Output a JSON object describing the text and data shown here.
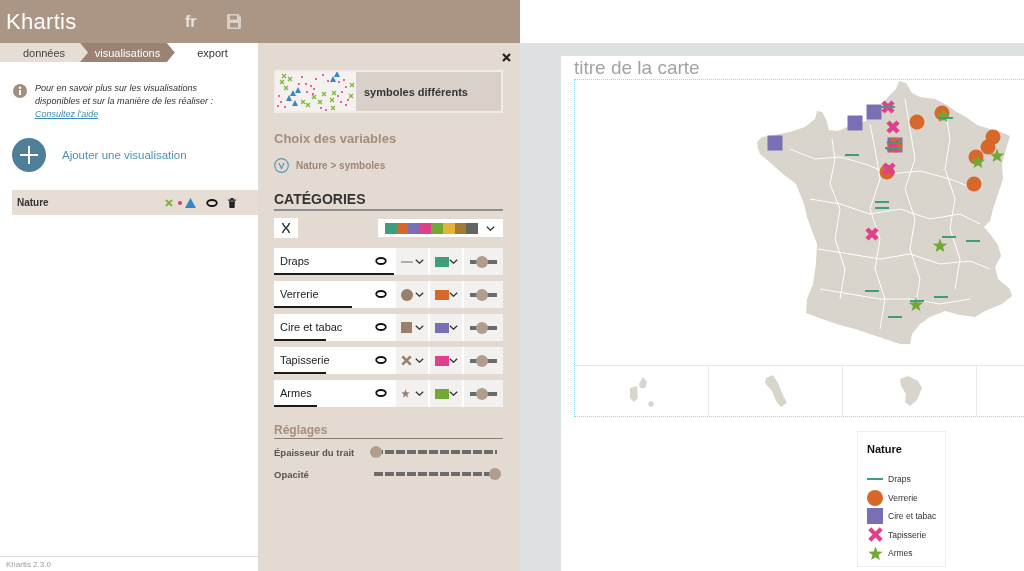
{
  "header": {
    "logo": "Khartis",
    "language": "fr"
  },
  "steps": [
    {
      "label": "données",
      "selected": false
    },
    {
      "label": "visualisations",
      "selected": true
    },
    {
      "label": "export",
      "selected": false
    }
  ],
  "info": {
    "text": "Pour en savoir plus sur les visualisations disponibles et sur la manière de les réaliser :",
    "link": "Consultez l'aide"
  },
  "add_button": {
    "label": "Ajouter une visualisation"
  },
  "visualizations": [
    {
      "name": "Nature",
      "selected": true,
      "visible": true
    }
  ],
  "footer": {
    "version": "Khartis 2.3.0"
  },
  "panel": {
    "viz_type": {
      "label": "symboles différents"
    },
    "variables_heading": "Choix des variables",
    "variable": {
      "label": "Nature > symboles"
    },
    "categories_heading": "CATÉGORIES",
    "palette": [
      {
        "color": "#3e9e7c"
      },
      {
        "color": "#d6692a"
      },
      {
        "color": "#7a6fb4"
      },
      {
        "color": "#df3f8b"
      },
      {
        "color": "#71a836"
      },
      {
        "color": "#e6b23c"
      },
      {
        "color": "#a27a33"
      },
      {
        "color": "#646464"
      }
    ],
    "categories": [
      {
        "name": "Draps",
        "visible": true,
        "kind": "line",
        "color": "#3e9e7c",
        "count_bar": {
          "level": 1
        },
        "size": {
          "level": 0.45
        }
      },
      {
        "name": "Verrerie",
        "visible": true,
        "kind": "circle",
        "color": "#d6692a",
        "count_bar": {
          "level": 0.65
        },
        "size": {
          "level": 0.45
        }
      },
      {
        "name": "Cire et tabac",
        "visible": true,
        "kind": "square",
        "color": "#7a6fb4",
        "count_bar": {
          "level": 0.43
        },
        "size": {
          "level": 0.45
        }
      },
      {
        "name": "Tapisserie",
        "visible": true,
        "kind": "cross",
        "color": "#df3f8b",
        "count_bar": {
          "level": 0.43
        },
        "size": {
          "level": 0.45
        }
      },
      {
        "name": "Armes",
        "visible": true,
        "kind": "star",
        "color": "#71a836",
        "count_bar": {
          "level": 0.36
        },
        "size": {
          "level": 0.45
        }
      }
    ],
    "settings_heading": "Réglages",
    "settings": [
      {
        "label": "Épaisseur du trait",
        "level": 0
      },
      {
        "label": "Opacité",
        "level": 1
      }
    ]
  },
  "map": {
    "title": {
      "placeholder": "titre de la carte"
    },
    "legend": {
      "title": "Nature",
      "items": [
        {
          "label": "Draps"
        },
        {
          "label": "Verrerie"
        },
        {
          "label": "Cire et tabac"
        },
        {
          "label": "Tapisserie"
        },
        {
          "label": "Armes"
        }
      ]
    }
  }
}
